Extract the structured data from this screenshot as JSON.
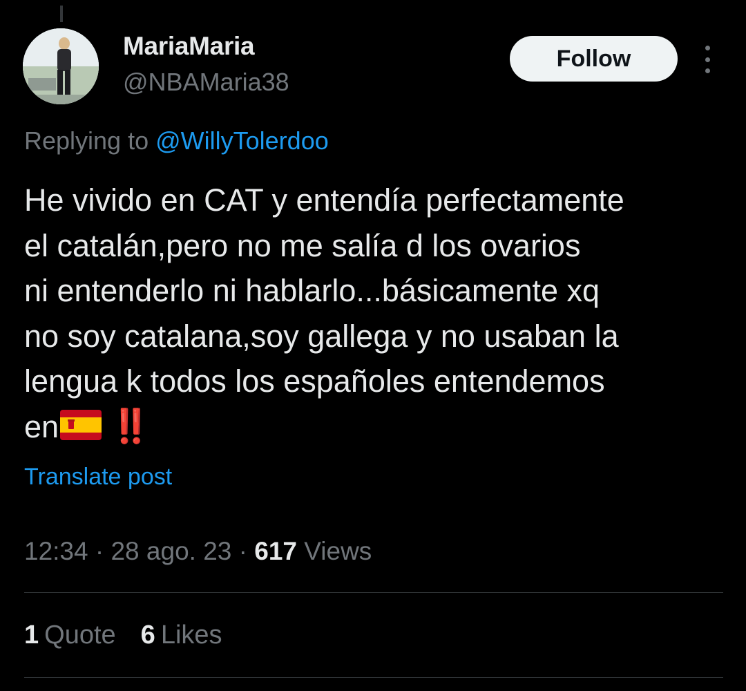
{
  "author": {
    "display_name": "MariaMaria",
    "handle": "@NBAMaria38",
    "avatar": "avatar-photo"
  },
  "follow_label": "Follow",
  "more_icon": "more-vertical-icon",
  "reply": {
    "prefix": "Replying to",
    "mention": "@WillyTolerdoo"
  },
  "tweet": {
    "lines": [
      "He vivido en CAT y entendía perfectamente",
      "el catalán,pero no me salía d los ovarios",
      "ni entenderlo ni hablarlo...básicamente xq",
      "no soy catalana,soy gallega y no usaban la",
      "lengua k todos los españoles entendemos",
      "en"
    ],
    "emojis": [
      "spain-flag-icon",
      "‼️"
    ]
  },
  "translate_label": "Translate post",
  "meta": {
    "time": "12:34",
    "sep": "·",
    "date": "28 ago. 23",
    "views_count": "617",
    "views_label": "Views"
  },
  "stats": {
    "quotes_count": "1",
    "quotes_label": "Quote",
    "likes_count": "6",
    "likes_label": "Likes"
  },
  "colors": {
    "background": "#000000",
    "text": "#e7e9ea",
    "secondary": "#71767b",
    "link": "#1d9bf0",
    "button_bg": "#eff3f4",
    "divider": "#2f3336"
  }
}
